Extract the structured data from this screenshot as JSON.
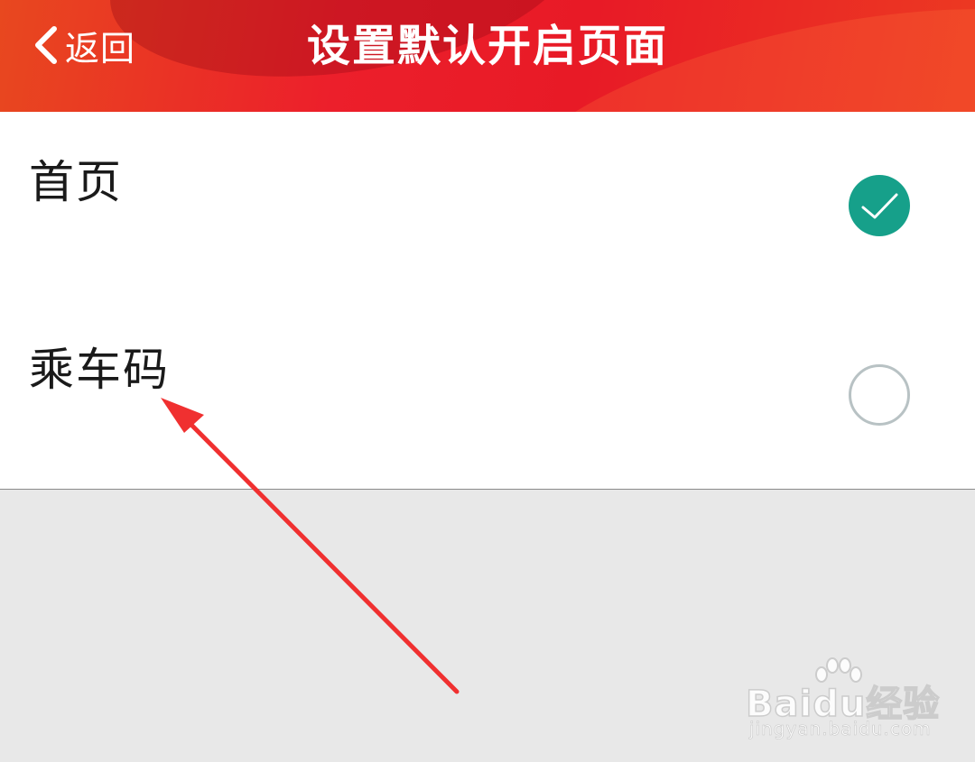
{
  "header": {
    "back_label": "返回",
    "title": "设置默认开启页面"
  },
  "options": [
    {
      "label": "首页",
      "selected": true
    },
    {
      "label": "乘车码",
      "selected": false
    }
  ],
  "colors": {
    "header_red": "#ec1f2b",
    "selected_green": "#16a08a",
    "annotation_arrow": "#f03030",
    "background": "#e8e8e8"
  },
  "watermark": {
    "logo_text": "Baidu经验",
    "url_text": "jingyan.baidu.com"
  }
}
